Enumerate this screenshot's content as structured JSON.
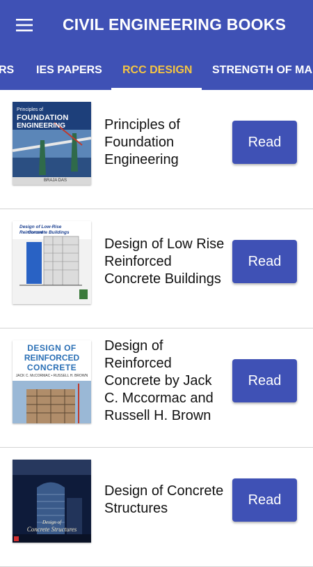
{
  "app": {
    "title": "CIVIL ENGINEERING BOOKS",
    "accent_color": "#3f51b5",
    "active_tab_color": "#f5c542",
    "menu_icon": "hamburger-menu-icon"
  },
  "tabs": [
    {
      "label": "RS"
    },
    {
      "label": "IES PAPERS"
    },
    {
      "label": "RCC DESIGN",
      "active": true
    },
    {
      "label": "STRENGTH OF MA"
    }
  ],
  "books": [
    {
      "title": "Principles of Foundation Engineering",
      "cover": {
        "line1": "Principles of",
        "line2": "FOUNDATION",
        "line3": "ENGINEERING",
        "author": "BRAJA DAS"
      },
      "button": "Read"
    },
    {
      "title": "Design of Low Rise Reinforced Concrete Buildings",
      "cover": {
        "line1": "Design of Low-Rise Reinforced",
        "line2": "Concrete Buildings"
      },
      "button": "Read"
    },
    {
      "title": "Design of Reinforced Concrete  by Jack C. Mccormac and Russell H. Brown",
      "cover": {
        "line1": "DESIGN OF",
        "line2": "REINFORCED",
        "line3": "CONCRETE",
        "author": "JACK C. McCORMAC • RUSSELL H. BROWN"
      },
      "button": "Read"
    },
    {
      "title": "Design of Concrete Structures",
      "cover": {
        "line1": "Design of",
        "line2": "Concrete Structures"
      },
      "button": "Read"
    }
  ]
}
